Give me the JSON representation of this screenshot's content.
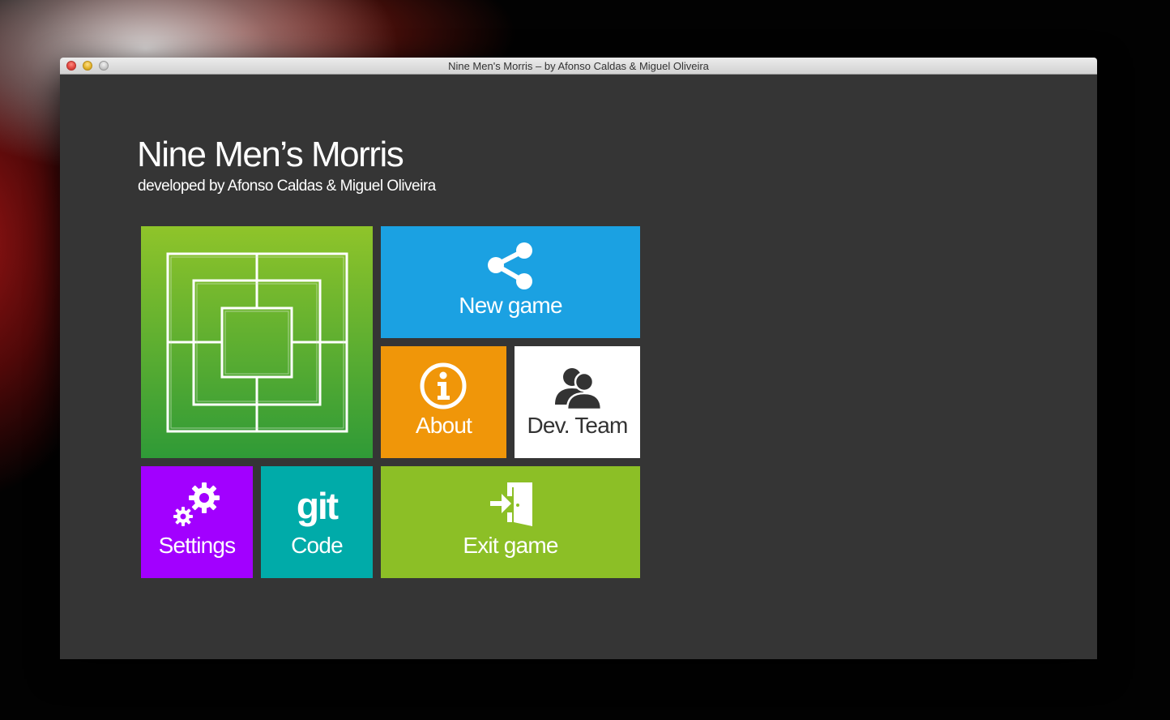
{
  "window": {
    "title": "Nine Men's Morris – by Afonso Caldas & Miguel Oliveira"
  },
  "header": {
    "title": "Nine Men’s Morris",
    "subtitle": "developed by Afonso Caldas & Miguel Oliveira"
  },
  "tiles": {
    "board": {
      "icon": "morris-board-icon",
      "color": "#5fae30"
    },
    "new_game": {
      "label": "New game",
      "icon": "share-icon",
      "color": "#1ba1e2"
    },
    "about": {
      "label": "About",
      "icon": "info-icon",
      "color": "#f09609"
    },
    "dev_team": {
      "label": "Dev. Team",
      "icon": "users-icon",
      "color": "#ffffff"
    },
    "settings": {
      "label": "Settings",
      "icon": "gears-icon",
      "color": "#a200ff"
    },
    "code": {
      "label": "Code",
      "icon_text": "git",
      "icon": "git-icon",
      "color": "#00aba9"
    },
    "exit": {
      "label": "Exit game",
      "icon": "exit-door-icon",
      "color": "#8cbf26"
    }
  }
}
